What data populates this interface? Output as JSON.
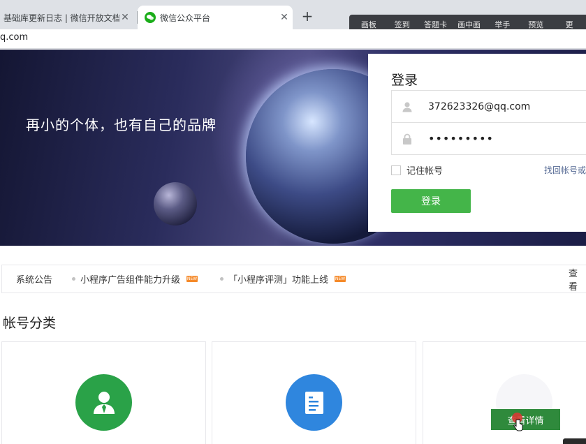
{
  "browser": {
    "tabs": [
      {
        "title": "基础库更新日志 | 微信开放文档",
        "close": "✕"
      },
      {
        "title": "微信公众平台",
        "close": "✕"
      }
    ],
    "new_tab": "+",
    "url": "q.com"
  },
  "toolbar": {
    "items": [
      "画板",
      "签到",
      "答题卡",
      "画中画",
      "举手",
      "预览",
      "更"
    ]
  },
  "banner": {
    "slogan": "再小的个体，也有自己的品牌"
  },
  "login": {
    "title": "登录",
    "account": "372623326@qq.com",
    "password": "•••••••••",
    "remember_label": "记住帐号",
    "forgot_label": "找回帐号或",
    "submit_label": "登录"
  },
  "notice": {
    "label": "系统公告",
    "items": [
      {
        "text": "小程序广告组件能力升级",
        "badge": "NEW"
      },
      {
        "text": "「小程序评测」功能上线",
        "badge": "NEW"
      }
    ],
    "more": "查看"
  },
  "categories": {
    "title": "帐号分类",
    "detail_button": "查看详情"
  },
  "colors": {
    "accent_green": "#44b549",
    "link_blue": "#576b95",
    "badge_orange": "#f58a2a"
  }
}
